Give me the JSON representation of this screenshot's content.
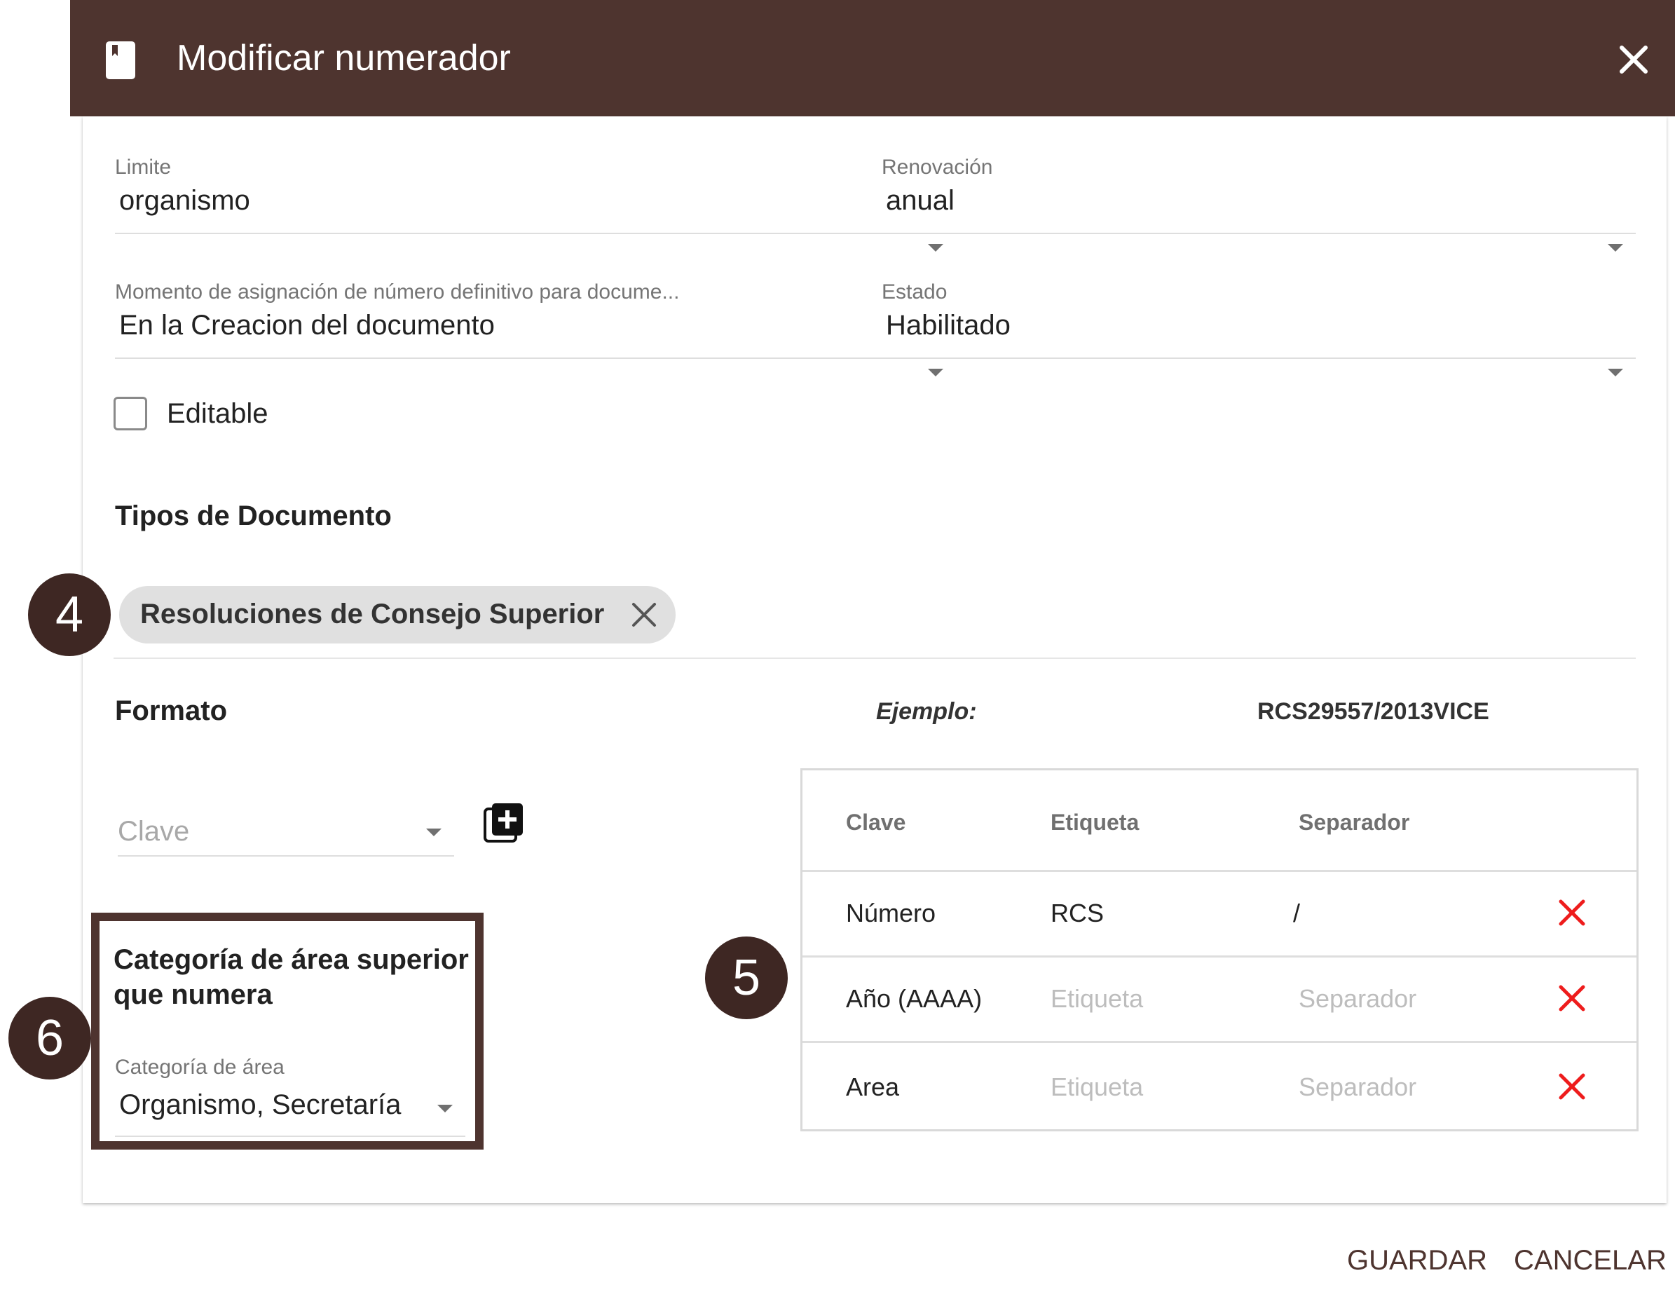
{
  "dialog": {
    "title": "Modificar numerador",
    "icon": "bookmark-book-icon",
    "header_color": "#4e342f"
  },
  "fields": {
    "limite": {
      "label": "Limite",
      "value": "organismo"
    },
    "renovacion": {
      "label": "Renovación",
      "value": "anual"
    },
    "momento": {
      "label": "Momento de asignación de número definitivo para docume...",
      "value": "En la Creacion del documento"
    },
    "estado": {
      "label": "Estado",
      "value": "Habilitado"
    }
  },
  "editable": {
    "label": "Editable",
    "checked": false
  },
  "tipos": {
    "title": "Tipos de Documento",
    "chips": [
      {
        "label": "Resoluciones de Consejo Superior"
      }
    ]
  },
  "formato": {
    "title": "Formato",
    "example_label": "Ejemplo:",
    "example_value": "RCS29557/2013VICE",
    "clave_placeholder": "Clave"
  },
  "categoria": {
    "title": "Categoría de área superior que numera",
    "field_label": "Categoría de área",
    "field_value": "Organismo, Secretaría"
  },
  "table": {
    "columns": [
      "Clave",
      "Etiqueta",
      "Separador"
    ],
    "rows": [
      {
        "clave": "Número",
        "etiqueta": "RCS",
        "separador": "/"
      },
      {
        "clave": "Año (AAAA)",
        "etiqueta": "Etiqueta",
        "separador": "Separador"
      },
      {
        "clave": "Area",
        "etiqueta": "Etiqueta",
        "separador": "Separador"
      }
    ],
    "delete_color": "#ee1c1c"
  },
  "markers": [
    "4",
    "5",
    "6"
  ],
  "footer": {
    "save": "GUARDAR",
    "cancel": "CANCELAR"
  }
}
